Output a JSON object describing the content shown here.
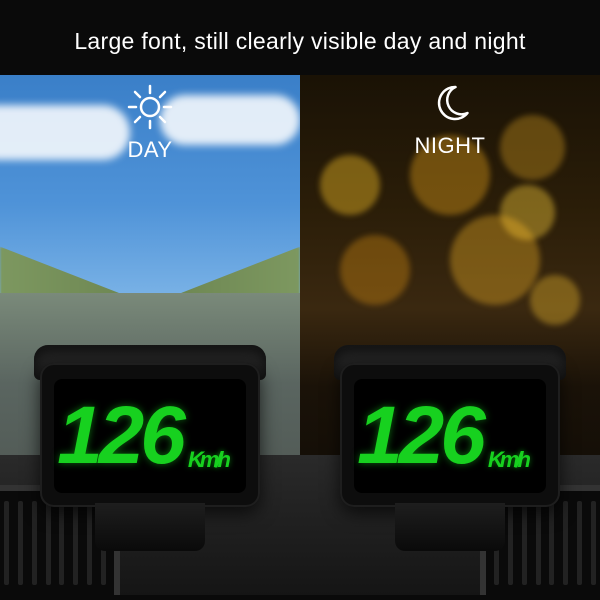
{
  "headline": "Large font, still clearly visible day and night",
  "left": {
    "label": "DAY",
    "speed": "126",
    "unit": "Km/h"
  },
  "right": {
    "label": "NIGHT",
    "speed": "126",
    "unit": "Km/h"
  },
  "colors": {
    "digit_green": "#17d11f"
  }
}
